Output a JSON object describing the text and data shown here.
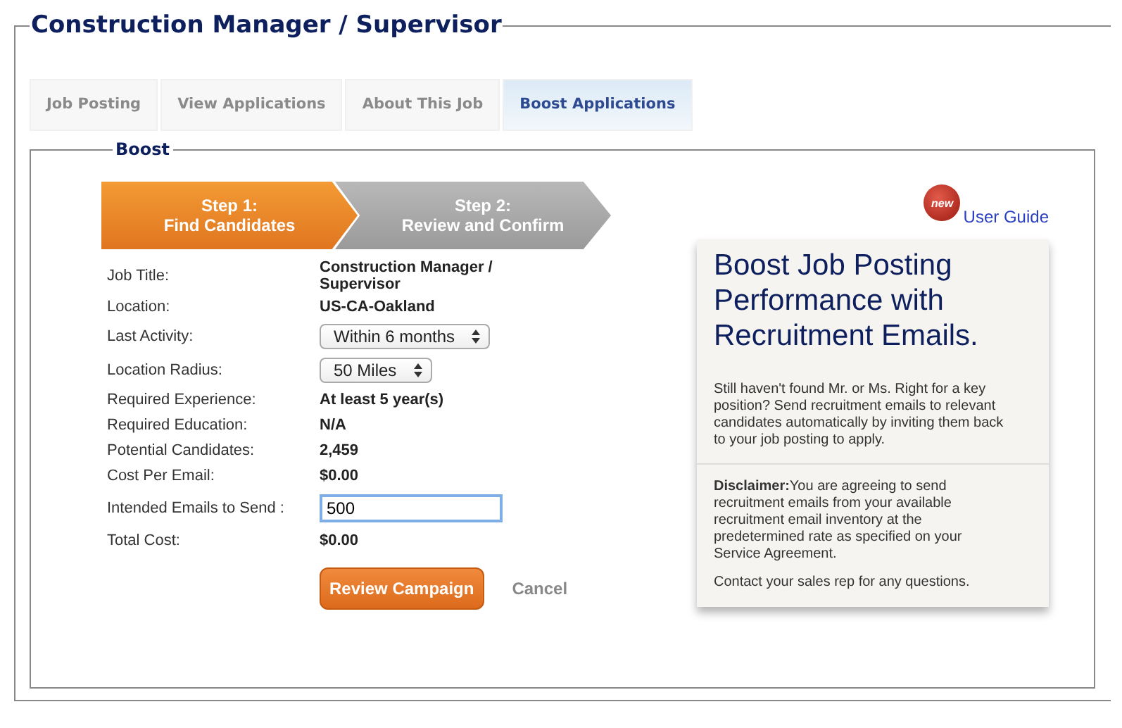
{
  "title": "Construction Manager / Supervisor",
  "tabs": [
    {
      "label": "Job Posting",
      "selected": false
    },
    {
      "label": "View Applications",
      "selected": false
    },
    {
      "label": "About This Job",
      "selected": false
    },
    {
      "label": "Boost Applications",
      "selected": true
    }
  ],
  "section_title": "Boost",
  "steps": [
    {
      "label": "Step 1:\nFind Candidates",
      "selected": true
    },
    {
      "label": "Step 2:\nReview and Confirm",
      "selected": false
    }
  ],
  "user_guide": {
    "badge": "new",
    "label": "User Guide"
  },
  "form": [
    {
      "kind": "text",
      "label": "Job Title:",
      "value": "Construction Manager / Supervisor"
    },
    {
      "kind": "text",
      "label": "Location:",
      "value": "US-CA-Oakland"
    },
    {
      "kind": "select",
      "label": "Last Activity:",
      "value": "Within 6 months"
    },
    {
      "kind": "select",
      "label": "Location Radius:",
      "value": "50 Miles"
    },
    {
      "kind": "text",
      "label": "Required Experience:",
      "value": "At least 5 year(s)"
    },
    {
      "kind": "text",
      "label": "Required Education:",
      "value": "N/A"
    },
    {
      "kind": "text",
      "label": "Potential Candidates:",
      "value": "2,459"
    },
    {
      "kind": "text",
      "label": "Cost Per Email:",
      "value": "$0.00"
    },
    {
      "kind": "input",
      "label": "Intended Emails to Send :",
      "value": "500"
    },
    {
      "kind": "text",
      "label": "Total Cost:",
      "value": "$0.00"
    }
  ],
  "buttons": {
    "primary": "Review Campaign",
    "cancel": "Cancel"
  },
  "promo": {
    "heading": "Boost Job Posting Performance with Recruitment Emails.",
    "body": "Still haven't found Mr. or Ms. Right for a key position? Send recruitment emails to relevant candidates automatically by inviting them back\nto your job posting to apply.",
    "disclaimer": "**Disclaimer:**You are agreeing to send recruitment emails from your available recruitment email inventory at the predetermined rate as specified on your Service Agreement.",
    "contact": "Contact your sales rep for any questions."
  }
}
